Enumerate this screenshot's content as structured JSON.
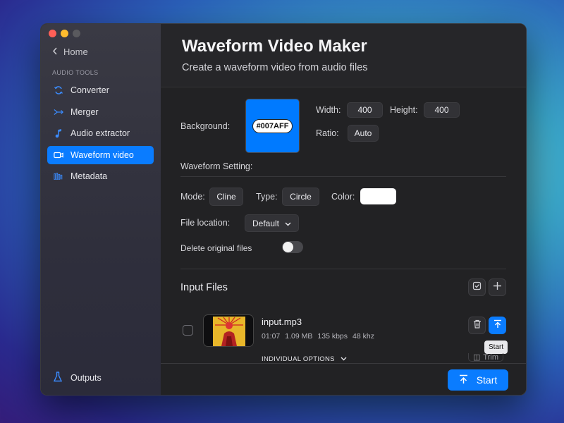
{
  "window": {
    "traffic_lights": [
      "#ff5f57",
      "#febc2e",
      "#5a5a5e"
    ]
  },
  "sidebar": {
    "home_label": "Home",
    "section_label": "AUDIO TOOLS",
    "items": [
      {
        "label": "Converter",
        "icon": "refresh-icon",
        "active": false
      },
      {
        "label": "Merger",
        "icon": "merge-icon",
        "active": false
      },
      {
        "label": "Audio extractor",
        "icon": "music-note-icon",
        "active": false
      },
      {
        "label": "Waveform video",
        "icon": "video-camera-icon",
        "active": true
      },
      {
        "label": "Metadata",
        "icon": "metadata-icon",
        "active": false
      }
    ],
    "outputs_label": "Outputs"
  },
  "header": {
    "title": "Waveform Video Maker",
    "subtitle": "Create a waveform video from audio files"
  },
  "settings": {
    "background_label": "Background:",
    "background_color": "#007AFF",
    "background_hex": "#007AFF",
    "width_label": "Width:",
    "width_value": "400",
    "height_label": "Height:",
    "height_value": "400",
    "ratio_label": "Ratio:",
    "ratio_value": "Auto",
    "waveform_setting_label": "Waveform Setting:",
    "mode_label": "Mode:",
    "mode_value": "Cline",
    "type_label": "Type:",
    "type_value": "Circle",
    "color_label": "Color:",
    "color_value": "#ffffff",
    "file_location_label": "File location:",
    "file_location_value": "Default",
    "delete_original_label": "Delete original files",
    "delete_original_on": false
  },
  "input_files": {
    "heading": "Input Files",
    "files": [
      {
        "name": "input.mp3",
        "duration": "01:07",
        "size": "1.09 MB",
        "bitrate": "135 kbps",
        "sample_rate": "48 khz",
        "options_label": "INDIVIDUAL OPTIONS",
        "trim_label": "Trim",
        "tooltip": "Start"
      }
    ]
  },
  "footer": {
    "start_label": "Start"
  },
  "colors": {
    "accent": "#0a7cff"
  }
}
